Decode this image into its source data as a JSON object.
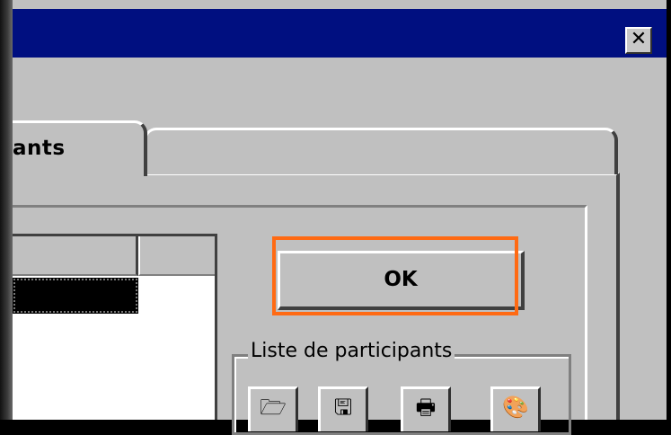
{
  "window": {
    "close_icon": "✕"
  },
  "tabs": {
    "active_label": "ants",
    "inactive_label": ""
  },
  "buttons": {
    "ok_label": "OK"
  },
  "group": {
    "label": "Liste de participants"
  },
  "toolbar": {
    "icons": [
      "open-folder-icon",
      "save-icon",
      "print-icon",
      "clipart-icon"
    ],
    "glyphs": [
      "🗁",
      "🖫",
      "🖶",
      "🎨"
    ]
  },
  "colors": {
    "titlebar": "#000f80",
    "dialog_face": "#c0c0c0",
    "focus_highlight": "#ff6a13"
  }
}
